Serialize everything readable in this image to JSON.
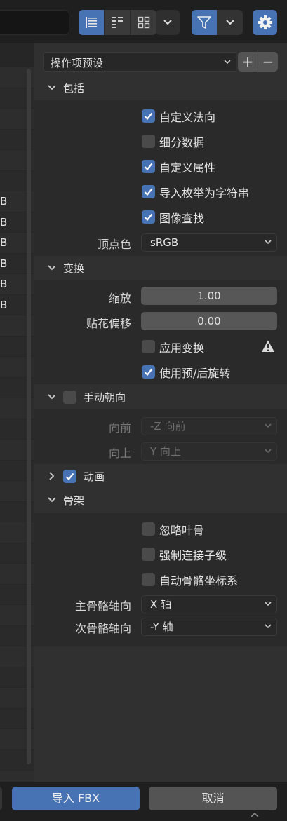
{
  "preset": {
    "label": "操作项预设",
    "add": "+",
    "remove": "−"
  },
  "file_list": {
    "rows": [
      "B",
      "B",
      "B",
      "B",
      "B",
      "B"
    ]
  },
  "sections": {
    "include": {
      "title": "包括",
      "options": [
        {
          "label": "自定义法向",
          "checked": true
        },
        {
          "label": "细分数据",
          "checked": false
        },
        {
          "label": "自定义属性",
          "checked": true
        },
        {
          "label": "导入枚举为字符串",
          "checked": true
        },
        {
          "label": "图像查找",
          "checked": true
        }
      ],
      "vertex_color": {
        "label": "顶点色",
        "value": "sRGB"
      }
    },
    "transform": {
      "title": "变换",
      "scale": {
        "label": "缩放",
        "value": "1.00"
      },
      "decal_offset": {
        "label": "贴花偏移",
        "value": "0.00"
      },
      "apply_transform": {
        "label": "应用变换",
        "checked": false
      },
      "use_prepost_rotation": {
        "label": "使用预/后旋转",
        "checked": true
      }
    },
    "manual_orientation": {
      "title": "手动朝向",
      "checked": false,
      "forward": {
        "label": "向前",
        "value": "-Z 向前"
      },
      "up": {
        "label": "向上",
        "value": "Y 向上"
      }
    },
    "animation": {
      "title": "动画",
      "checked": true
    },
    "armature": {
      "title": "骨架",
      "options": [
        {
          "label": "忽略叶骨",
          "checked": false
        },
        {
          "label": "强制连接子级",
          "checked": false
        },
        {
          "label": "自动骨骼坐标系",
          "checked": false
        }
      ],
      "primary_axis": {
        "label": "主骨骼轴向",
        "value": "X 轴"
      },
      "secondary_axis": {
        "label": "次骨骼轴向",
        "value": "-Y 轴"
      }
    }
  },
  "buttons": {
    "import": "导入 FBX",
    "cancel": "取消"
  },
  "icons": {
    "view_list": "list-view-icon",
    "view_detail": "detail-view-icon",
    "view_grid": "grid-view-icon",
    "filter": "filter-icon",
    "settings": "gear-icon",
    "warning": "warning-icon"
  },
  "colors": {
    "accent": "#4772b3",
    "panel": "#303030",
    "bar": "#1f1f1f"
  }
}
